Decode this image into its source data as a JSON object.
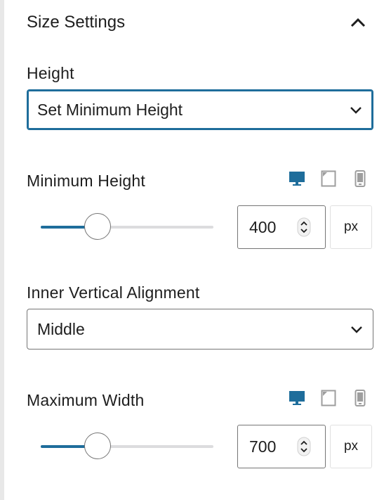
{
  "section": {
    "title": "Size Settings"
  },
  "height": {
    "label": "Height",
    "value": "Set Minimum Height"
  },
  "minimum_height": {
    "label": "Minimum Height",
    "value": "400",
    "unit": "px",
    "slider_fraction": 0.33,
    "active_device": "desktop"
  },
  "vertical_alignment": {
    "label": "Inner Vertical Alignment",
    "value": "Middle"
  },
  "maximum_width": {
    "label": "Maximum Width",
    "value": "700",
    "unit": "px",
    "slider_fraction": 0.33,
    "active_device": "desktop"
  },
  "colors": {
    "accent": "#1e6d9b",
    "inactive_icon": "#9e9e9e",
    "track": "#dcdcde",
    "text": "#1e1e1e"
  },
  "icons": {
    "collapse": "chevron-up-icon",
    "select": "chevron-down-icon",
    "devices": [
      "desktop-icon",
      "tablet-icon",
      "mobile-icon"
    ],
    "spinner": "spinner-arrows-icon"
  }
}
